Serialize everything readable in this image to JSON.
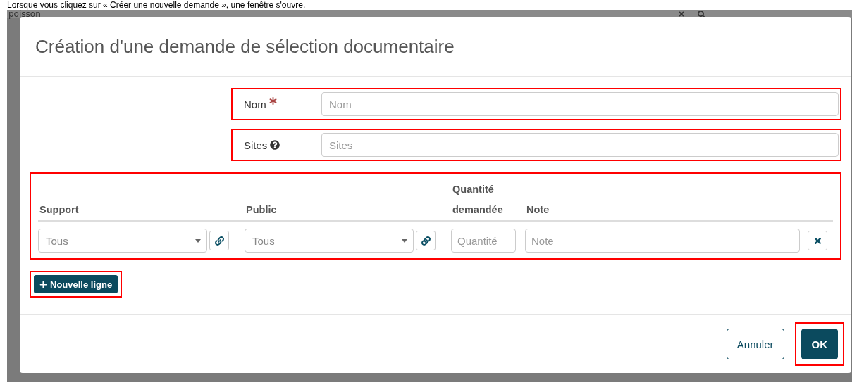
{
  "caption": "Lorsque vous cliquez sur « Créer une nouvelle demande », une fenêtre s'ouvre.",
  "background": {
    "search_value": "poisson"
  },
  "dialog": {
    "title": "Création d'une demande de sélection documentaire",
    "fields": [
      {
        "label": "Nom",
        "required": true,
        "help": false,
        "placeholder": "Nom"
      },
      {
        "label": "Sites",
        "required": false,
        "help": true,
        "placeholder": "Sites"
      }
    ],
    "table": {
      "columns": [
        {
          "label": "Support"
        },
        {
          "label": "Public"
        },
        {
          "label": "Quantité demandée"
        },
        {
          "label": "Note"
        }
      ],
      "rows": [
        {
          "cells": [
            {
              "kind": "select",
              "value": "Tous"
            },
            {
              "kind": "select",
              "value": "Tous"
            },
            {
              "kind": "input",
              "placeholder": "Quantité"
            },
            {
              "kind": "input",
              "placeholder": "Note"
            }
          ]
        }
      ]
    },
    "add_button": "Nouvelle ligne",
    "buttons": [
      {
        "label": "Annuler",
        "kind": "secondary"
      },
      {
        "label": "OK",
        "kind": "primary"
      }
    ]
  }
}
